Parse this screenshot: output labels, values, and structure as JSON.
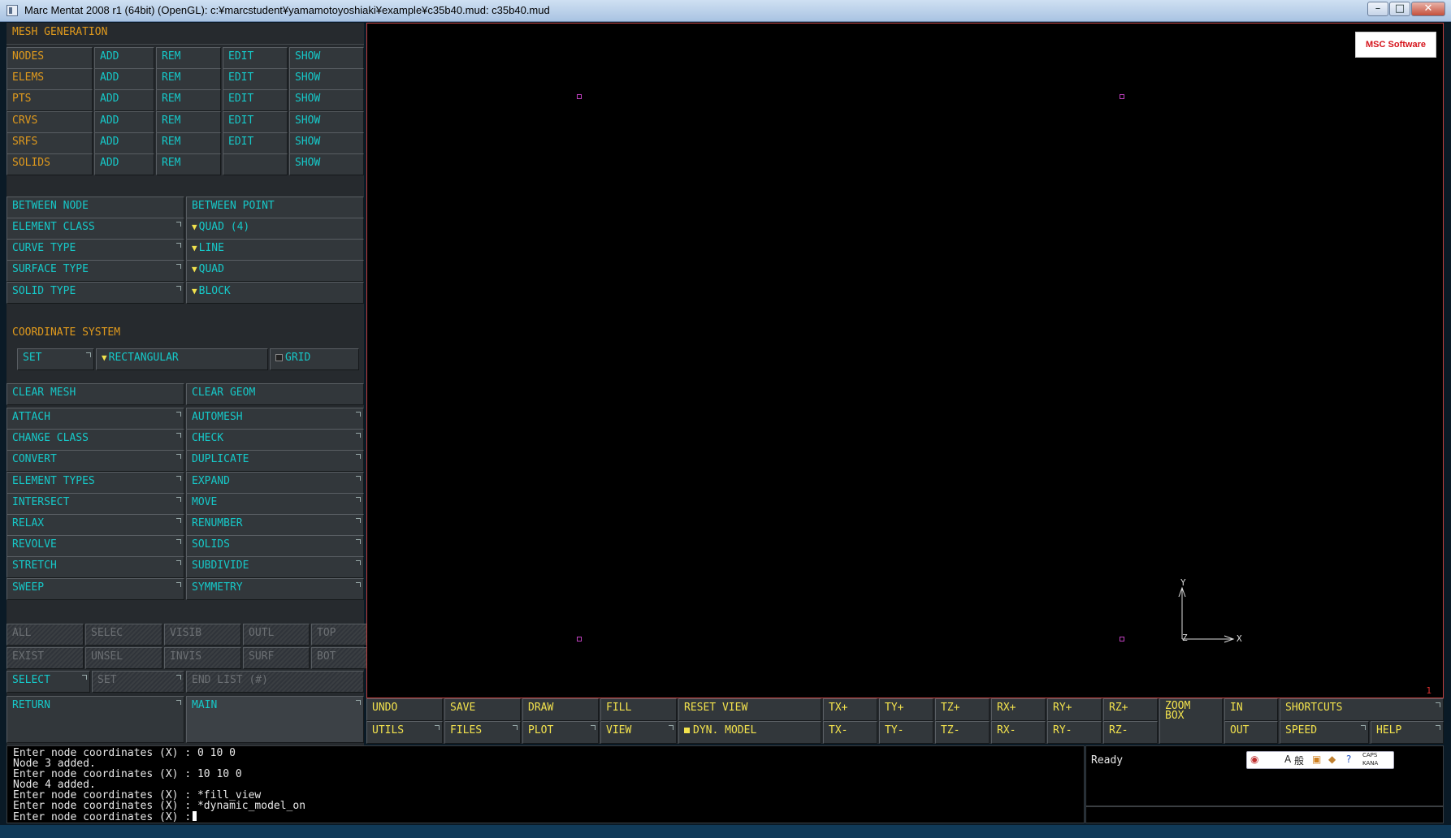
{
  "window": {
    "title": "Marc Mentat 2008 r1 (64bit) (OpenGL): c:¥marcstudent¥yamamotoyoshiaki¥example¥c35b40.mud: c35b40.mud",
    "minimize": "–",
    "maximize": "□",
    "close": "✕"
  },
  "panel": {
    "heading": "MESH GENERATION",
    "entity_rows": [
      {
        "label": "NODES",
        "add": "ADD",
        "rem": "REM",
        "edit": "EDIT",
        "show": "SHOW"
      },
      {
        "label": "ELEMS",
        "add": "ADD",
        "rem": "REM",
        "edit": "EDIT",
        "show": "SHOW"
      },
      {
        "label": "PTS",
        "add": "ADD",
        "rem": "REM",
        "edit": "EDIT",
        "show": "SHOW"
      },
      {
        "label": "CRVS",
        "add": "ADD",
        "rem": "REM",
        "edit": "EDIT",
        "show": "SHOW"
      },
      {
        "label": "SRFS",
        "add": "ADD",
        "rem": "REM",
        "edit": "EDIT",
        "show": "SHOW"
      },
      {
        "label": "SOLIDS",
        "add": "ADD",
        "rem": "REM",
        "edit": "",
        "show": "SHOW"
      }
    ],
    "between_node": "BETWEEN NODE",
    "between_point": "BETWEEN POINT",
    "type_rows": [
      {
        "label": "ELEMENT CLASS",
        "value": "QUAD (4)"
      },
      {
        "label": "CURVE TYPE",
        "value": "LINE"
      },
      {
        "label": "SURFACE TYPE",
        "value": "QUAD"
      },
      {
        "label": "SOLID TYPE",
        "value": "BLOCK"
      }
    ],
    "coord_heading": "COORDINATE SYSTEM",
    "coord_set": "SET",
    "coord_type": "RECTANGULAR",
    "coord_grid": "GRID",
    "clear_mesh": "CLEAR MESH",
    "clear_geom": "CLEAR GEOM",
    "ops": [
      [
        "ATTACH",
        "AUTOMESH"
      ],
      [
        "CHANGE CLASS",
        "CHECK"
      ],
      [
        "CONVERT",
        "DUPLICATE"
      ],
      [
        "ELEMENT TYPES",
        "EXPAND"
      ],
      [
        "INTERSECT",
        "MOVE"
      ],
      [
        "RELAX",
        "RENUMBER"
      ],
      [
        "REVOLVE",
        "SOLIDS"
      ],
      [
        "STRETCH",
        "SUBDIVIDE"
      ],
      [
        "SWEEP",
        "SYMMETRY"
      ]
    ],
    "sel_row1": [
      "ALL",
      "SELEC",
      "VISIB",
      "OUTL",
      "TOP"
    ],
    "sel_row2": [
      "EXIST",
      "UNSEL",
      "INVIS",
      "SURF",
      "BOT"
    ],
    "select": "SELECT",
    "set": "SET",
    "end_list": "END LIST (#)",
    "return": "RETURN",
    "main": "MAIN"
  },
  "viewport": {
    "logo": "MSC Software",
    "axis_y": "Y",
    "axis_x": "X",
    "axis_z": "Z",
    "corner_number": "1",
    "marker_color": "#c040c0"
  },
  "toolbar": {
    "undo": "UNDO",
    "save": "SAVE",
    "draw": "DRAW",
    "fill": "FILL",
    "reset_view": "RESET VIEW",
    "utils": "UTILS",
    "files": "FILES",
    "plot": "PLOT",
    "view": "VIEW",
    "dyn_model": "DYN. MODEL",
    "tx_plus": "TX+",
    "ty_plus": "TY+",
    "tz_plus": "TZ+",
    "rx_plus": "RX+",
    "ry_plus": "RY+",
    "rz_plus": "RZ+",
    "tx_minus": "TX-",
    "ty_minus": "TY-",
    "tz_minus": "TZ-",
    "rx_minus": "RX-",
    "ry_minus": "RY-",
    "rz_minus": "RZ-",
    "zoom_box": "ZOOM BOX",
    "in": "IN",
    "out": "OUT",
    "shortcuts": "SHORTCUTS",
    "speed": "SPEED",
    "help": "HELP"
  },
  "console": {
    "lines": [
      "Enter node coordinates (X) : 0 10 0",
      "Node 3 added.",
      "Enter node coordinates (X) : 10 10 0",
      "Node 4 added.",
      "Enter node coordinates (X) : *fill_view",
      "Enter node coordinates (X) : *dynamic_model_on",
      "Enter node coordinates (X) :"
    ]
  },
  "status": {
    "text": "Ready"
  },
  "langbar": {
    "a": "A",
    "mode": "般",
    "caps": "CAPS",
    "kana": "KANA"
  }
}
